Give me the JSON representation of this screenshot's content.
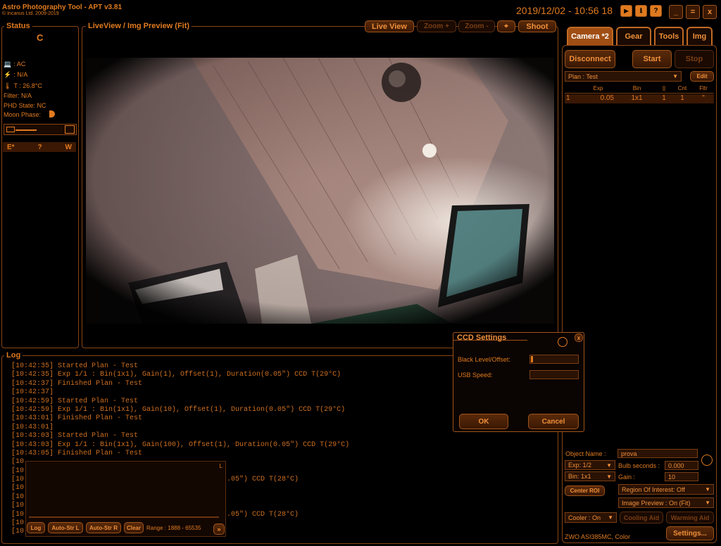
{
  "app": {
    "title": "Astro Photography Tool  -  APT v3.81",
    "copyright": "© Incanus Ltd. 2009-2019",
    "datetime": "2019/12/02 - 10:56 18"
  },
  "status": {
    "title": "Status",
    "letter": "C",
    "power": ": AC",
    "link": ": N/A",
    "temp": "T : 26.8°C",
    "filter": "Filter: N/A",
    "phd": "PHD State: NC",
    "moon": "Moon Phase:",
    "compass": [
      "E*",
      "?",
      "W"
    ]
  },
  "liveview": {
    "title": "LiveView / Img Preview (Fit)",
    "live_view": "Live View",
    "zoom_plus": "Zoom +",
    "zoom_minus": "Zoom -",
    "shoot": "Shoot"
  },
  "tabs": [
    {
      "label": "Camera *2"
    },
    {
      "label": "Gear"
    },
    {
      "label": "Tools"
    },
    {
      "label": "Img"
    }
  ],
  "camera": {
    "disconnect": "Disconnect",
    "start": "Start",
    "stop": "Stop",
    "plan": "Plan : Test",
    "edit": "Edit",
    "table_headers": [
      "",
      "Exp",
      "Bin",
      "||",
      "Cnt",
      "Fltr"
    ],
    "table_row": [
      "1",
      "0.05",
      "1x1",
      "1",
      "1",
      "\""
    ],
    "object_name_label": "Object Name :",
    "object_name": "prova",
    "exp": "Exp: 1/2",
    "bulb_label": "Bulb seconds :",
    "bulb": "0.000",
    "bin": "Bin: 1x1",
    "gain_label": "Gain :",
    "gain": "10",
    "center_roi": "Center ROI",
    "roi": "Region Of Interest: Off",
    "image_preview": "Image Preview : On (Fit)",
    "cooler": "Cooler : On",
    "cooling_aid": "Cooling Aid",
    "warming_aid": "Warming Aid",
    "camera_name": "ZWO ASI385MC, Color",
    "settings": "Settings..."
  },
  "log": {
    "title": "Log",
    "lines": [
      "[10:42:35] Started Plan - Test",
      "[10:42:35] Exp 1/1 : Bin(1x1), Gain(1), Offset(1), Duration(0.05\") CCD T(29°C)",
      "[10:42:37] Finished Plan - Test",
      "[10:42:37]",
      "[10:42:59] Started Plan - Test",
      "[10:42:59] Exp 1/1 : Bin(1x1), Gain(10), Offset(1), Duration(0.05\") CCD T(29°C)",
      "[10:43:01] Finished Plan - Test",
      "[10:43:01]",
      "[10:43:03] Started Plan - Test",
      "[10:43:03] Exp 1/1 : Bin(1x1), Gain(100), Offset(1), Duration(0.05\") CCD T(29°C)",
      "[10:43:05] Finished Plan - Test"
    ],
    "partial_lines": [
      "[10",
      "[10",
      "[10",
      "[10",
      "[10",
      "[10",
      "[10",
      "[10",
      "[10"
    ],
    "partial_right_1": ".05\") CCD T(28°C)",
    "partial_right_2": ".05\") CCD T(28°C)"
  },
  "histogram": {
    "corner": "L",
    "log": "Log",
    "auto_str_l": "Auto-Str L",
    "auto_str_r": "Auto-Str R",
    "clear": "Clear",
    "range": "Range : 1888 - 65535"
  },
  "ccd_dialog": {
    "title": "CCD Settings",
    "close": "x",
    "black_level": "Black Level/Offset:",
    "usb_speed": "USB Speed:",
    "ok": "OK",
    "cancel": "Cancel"
  },
  "colors": {
    "accent": "#e07a1f",
    "border": "#8a4515",
    "bg": "#000000"
  }
}
